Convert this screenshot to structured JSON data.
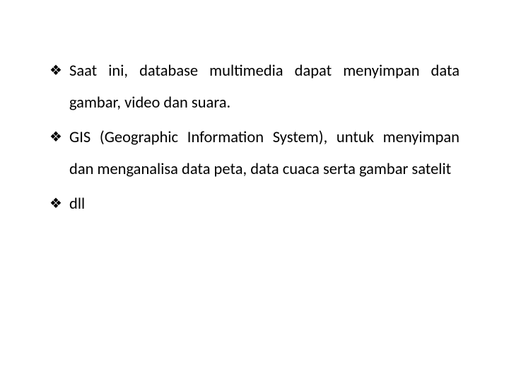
{
  "bullets": [
    {
      "text": "Saat ini, database multimedia dapat menyimpan  data gambar, video dan suara."
    },
    {
      "text": " GIS (Geographic Information System), untuk menyimpan dan menganalisa data peta, data cuaca serta gambar satelit"
    },
    {
      "text": " dll"
    }
  ]
}
